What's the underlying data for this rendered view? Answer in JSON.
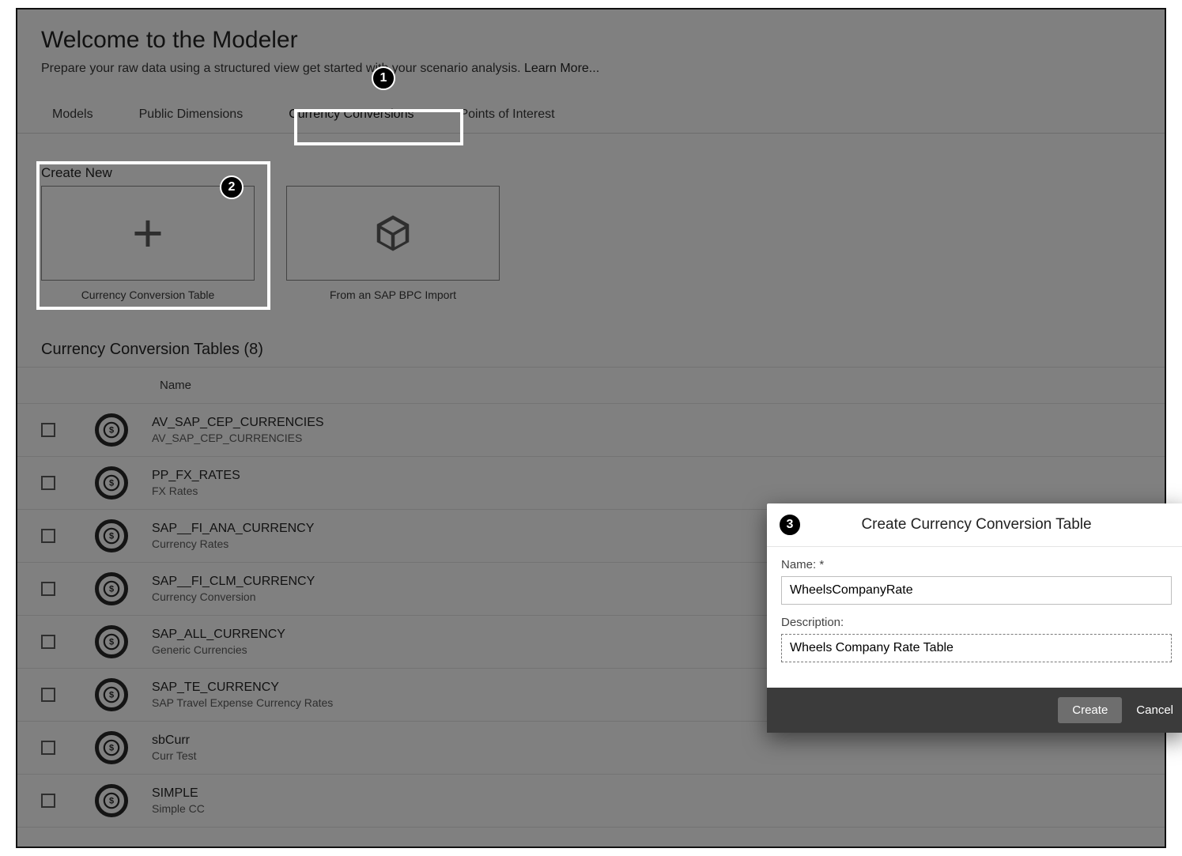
{
  "header": {
    "title": "Welcome to the Modeler",
    "subtitle_pre": "Prepare your raw data using a structured view",
    "subtitle_post": " get started with your scenario analysis.  ",
    "learn_more": "Learn More..."
  },
  "tabs": [
    {
      "label": "Models"
    },
    {
      "label": "Public Dimensions"
    },
    {
      "label": "Currency Conversions",
      "active": true
    },
    {
      "label": "Points of Interest"
    }
  ],
  "create": {
    "heading": "Create New",
    "cards": [
      {
        "caption": "Currency Conversion Table"
      },
      {
        "caption": "From an SAP BPC Import"
      }
    ]
  },
  "section_title": "Currency Conversion Tables (8)",
  "column_header": "Name",
  "rows": [
    {
      "title": "AV_SAP_CEP_CURRENCIES",
      "sub": "AV_SAP_CEP_CURRENCIES"
    },
    {
      "title": "PP_FX_RATES",
      "sub": "FX Rates"
    },
    {
      "title": "SAP__FI_ANA_CURRENCY",
      "sub": "Currency Rates"
    },
    {
      "title": "SAP__FI_CLM_CURRENCY",
      "sub": "Currency Conversion"
    },
    {
      "title": "SAP_ALL_CURRENCY",
      "sub": "Generic Currencies"
    },
    {
      "title": "SAP_TE_CURRENCY",
      "sub": "SAP Travel Expense Currency Rates"
    },
    {
      "title": "sbCurr",
      "sub": "Curr Test"
    },
    {
      "title": "SIMPLE",
      "sub": "Simple CC"
    }
  ],
  "dialog": {
    "title": "Create Currency Conversion Table",
    "name_label": "Name: *",
    "name_value": "WheelsCompanyRate",
    "desc_label": "Description:",
    "desc_value": "Wheels Company Rate Table",
    "create_btn": "Create",
    "cancel_btn": "Cancel"
  },
  "callouts": {
    "c1": "1",
    "c2": "2",
    "c3": "3"
  }
}
